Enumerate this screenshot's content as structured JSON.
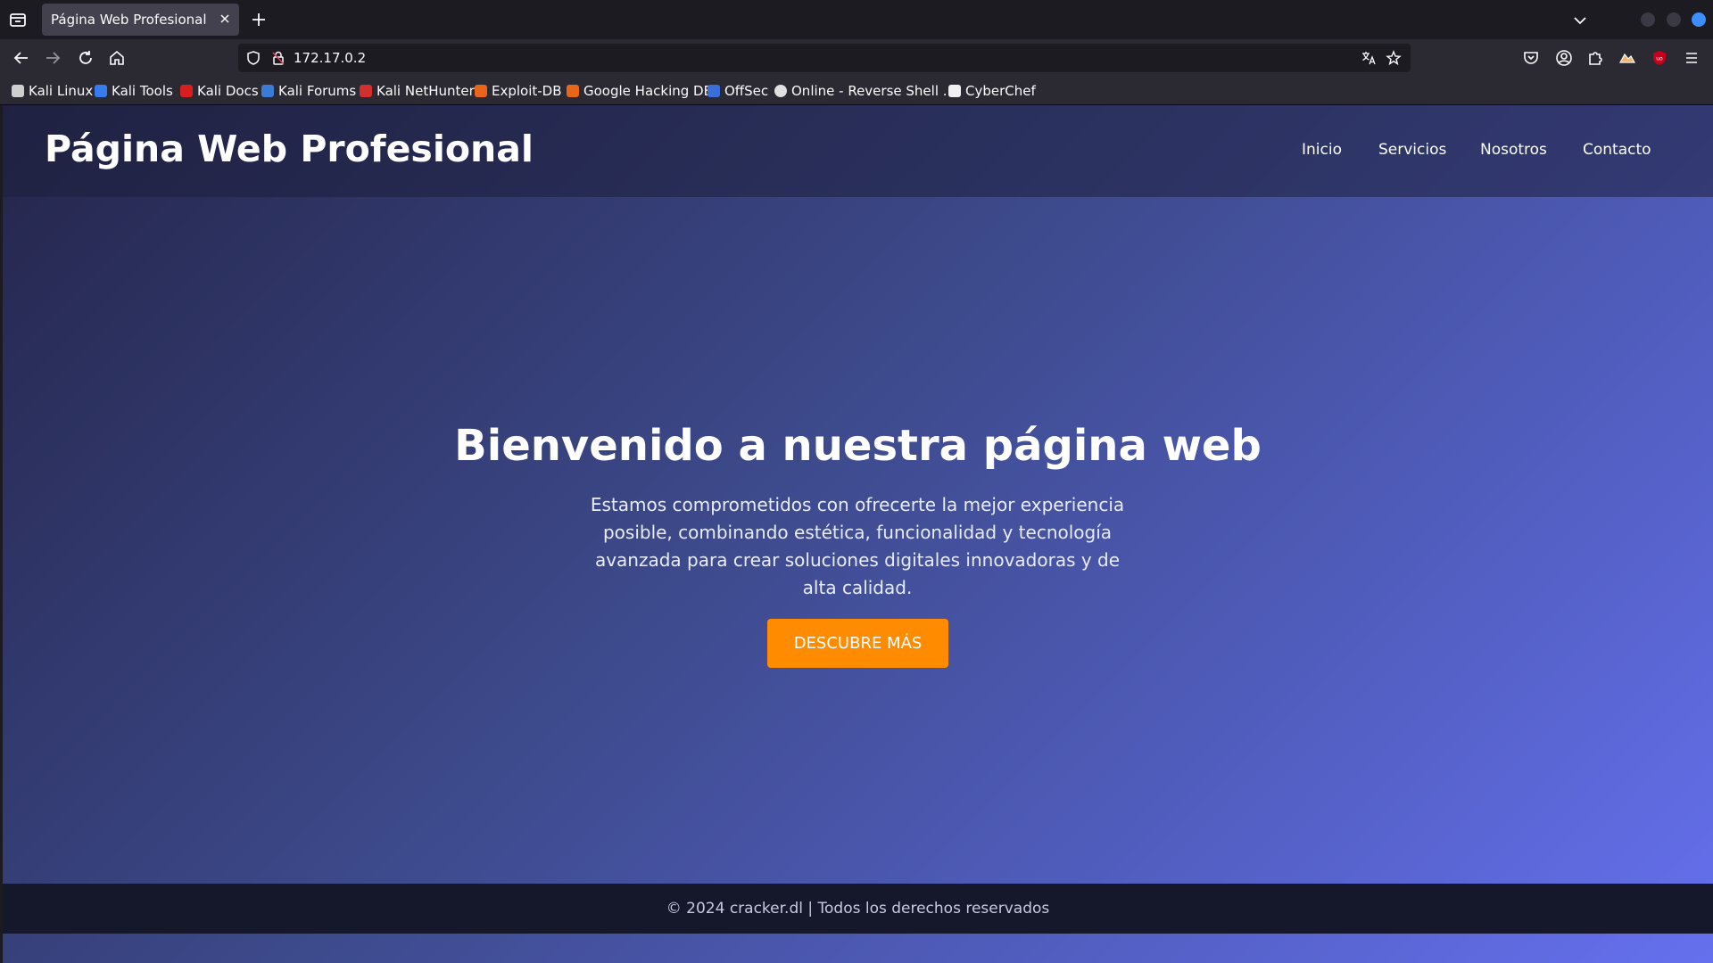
{
  "tab": {
    "title": "Página Web Profesional"
  },
  "urlbar": {
    "url": "172.17.0.2"
  },
  "extensions": {
    "badge_count": "1"
  },
  "bookmarks": [
    {
      "label": "Kali Linux",
      "icon": "kali-dragon-icon",
      "color": "#cfcfcf"
    },
    {
      "label": "Kali Tools",
      "icon": "kali-tools-icon",
      "color": "#367bf0"
    },
    {
      "label": "Kali Docs",
      "icon": "kali-docs-icon",
      "color": "#d81e1e"
    },
    {
      "label": "Kali Forums",
      "icon": "kali-forums-icon",
      "color": "#3b7bd6"
    },
    {
      "label": "Kali NetHunter",
      "icon": "kali-nethunter-icon",
      "color": "#d32f2f"
    },
    {
      "label": "Exploit-DB",
      "icon": "exploit-db-icon",
      "color": "#e8651a"
    },
    {
      "label": "Google Hacking DB",
      "icon": "ghdb-icon",
      "color": "#e8651a"
    },
    {
      "label": "OffSec",
      "icon": "offsec-icon",
      "color": "#3a6fd8"
    },
    {
      "label": "Online - Reverse Shell ...",
      "icon": "skull-icon",
      "color": "#e0e0e0"
    },
    {
      "label": "CyberChef",
      "icon": "chef-hat-icon",
      "color": "#f0f0f0"
    }
  ],
  "site": {
    "title": "Página Web Profesional",
    "nav": [
      "Inicio",
      "Servicios",
      "Nosotros",
      "Contacto"
    ],
    "hero_title": "Bienvenido a nuestra página web",
    "hero_text": "Estamos comprometidos con ofrecerte la mejor experiencia posible, combinando estética, funcionalidad y tecnología avanzada para crear soluciones digitales innovadoras y de alta calidad.",
    "hero_button": "DESCUBRE MÁS",
    "footer": "© 2024 cracker.dl | Todos los derechos reservados"
  },
  "colors": {
    "accent_button": "#ff8c00",
    "tab_bg": "#42414d",
    "toolbar_bg": "#2b2a33"
  }
}
